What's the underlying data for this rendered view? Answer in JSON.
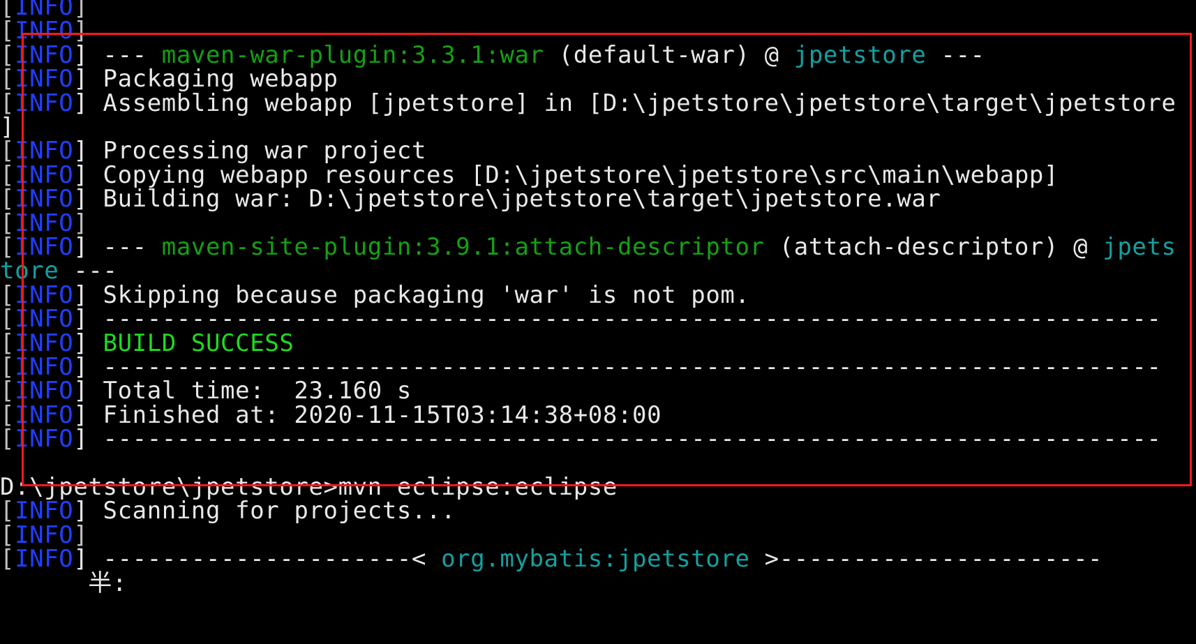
{
  "terminal": {
    "lines": [
      {
        "segments": [
          {
            "text": "[",
            "style": "bracket"
          },
          {
            "text": "INFO",
            "style": "tag"
          },
          {
            "text": "]",
            "style": "bracket"
          }
        ]
      },
      {
        "segments": [
          {
            "text": "[",
            "style": "bracket"
          },
          {
            "text": "INFO",
            "style": "tag"
          },
          {
            "text": "]",
            "style": "bracket"
          }
        ]
      },
      {
        "segments": [
          {
            "text": "[",
            "style": "bracket"
          },
          {
            "text": "INFO",
            "style": "tag"
          },
          {
            "text": "] --- ",
            "style": "bracket-white"
          },
          {
            "text": "maven-war-plugin:3.3.1:war",
            "style": "plugin"
          },
          {
            "text": " (default-war) @ ",
            "style": "white"
          },
          {
            "text": "jpetstore",
            "style": "project"
          },
          {
            "text": " ---",
            "style": "white"
          }
        ]
      },
      {
        "segments": [
          {
            "text": "[",
            "style": "bracket"
          },
          {
            "text": "INFO",
            "style": "tag"
          },
          {
            "text": "] Packaging webapp",
            "style": "bracket-white"
          }
        ]
      },
      {
        "segments": [
          {
            "text": "[",
            "style": "bracket"
          },
          {
            "text": "INFO",
            "style": "tag"
          },
          {
            "text": "] Assembling webapp [jpetstore] in [D:\\jpetstore\\jpetstore\\target\\jpetstore",
            "style": "bracket-white"
          }
        ]
      },
      {
        "segments": [
          {
            "text": "]",
            "style": "white"
          }
        ]
      },
      {
        "segments": [
          {
            "text": "[",
            "style": "bracket"
          },
          {
            "text": "INFO",
            "style": "tag"
          },
          {
            "text": "] Processing war project",
            "style": "bracket-white"
          }
        ]
      },
      {
        "segments": [
          {
            "text": "[",
            "style": "bracket"
          },
          {
            "text": "INFO",
            "style": "tag"
          },
          {
            "text": "] Copying webapp resources [D:\\jpetstore\\jpetstore\\src\\main\\webapp]",
            "style": "bracket-white"
          }
        ]
      },
      {
        "segments": [
          {
            "text": "[",
            "style": "bracket"
          },
          {
            "text": "INFO",
            "style": "tag"
          },
          {
            "text": "] Building war: D:\\jpetstore\\jpetstore\\target\\jpetstore.war",
            "style": "bracket-white"
          }
        ]
      },
      {
        "segments": [
          {
            "text": "[",
            "style": "bracket"
          },
          {
            "text": "INFO",
            "style": "tag"
          },
          {
            "text": "]",
            "style": "bracket"
          }
        ]
      },
      {
        "segments": [
          {
            "text": "[",
            "style": "bracket"
          },
          {
            "text": "INFO",
            "style": "tag"
          },
          {
            "text": "] --- ",
            "style": "bracket-white"
          },
          {
            "text": "maven-site-plugin:3.9.1:attach-descriptor",
            "style": "plugin"
          },
          {
            "text": " (attach-descriptor) @ ",
            "style": "white"
          },
          {
            "text": "jpets",
            "style": "project"
          }
        ]
      },
      {
        "segments": [
          {
            "text": "tore",
            "style": "project"
          },
          {
            "text": " ---",
            "style": "white"
          }
        ]
      },
      {
        "segments": [
          {
            "text": "[",
            "style": "bracket"
          },
          {
            "text": "INFO",
            "style": "tag"
          },
          {
            "text": "] Skipping because packaging 'war' is not pom.",
            "style": "bracket-white"
          }
        ]
      },
      {
        "segments": [
          {
            "text": "[",
            "style": "bracket"
          },
          {
            "text": "INFO",
            "style": "tag"
          },
          {
            "text": "] ------------------------------------------------------------------------",
            "style": "bracket-white"
          }
        ]
      },
      {
        "segments": [
          {
            "text": "[",
            "style": "bracket"
          },
          {
            "text": "INFO",
            "style": "tag"
          },
          {
            "text": "] ",
            "style": "bracket-white"
          },
          {
            "text": "BUILD SUCCESS",
            "style": "success"
          }
        ]
      },
      {
        "segments": [
          {
            "text": "[",
            "style": "bracket"
          },
          {
            "text": "INFO",
            "style": "tag"
          },
          {
            "text": "] ------------------------------------------------------------------------",
            "style": "bracket-white"
          }
        ]
      },
      {
        "segments": [
          {
            "text": "[",
            "style": "bracket"
          },
          {
            "text": "INFO",
            "style": "tag"
          },
          {
            "text": "] Total time:  23.160 s",
            "style": "bracket-white"
          }
        ]
      },
      {
        "segments": [
          {
            "text": "[",
            "style": "bracket"
          },
          {
            "text": "INFO",
            "style": "tag"
          },
          {
            "text": "] Finished at: 2020-11-15T03:14:38+08:00",
            "style": "bracket-white"
          }
        ]
      },
      {
        "segments": [
          {
            "text": "[",
            "style": "bracket"
          },
          {
            "text": "INFO",
            "style": "tag"
          },
          {
            "text": "] ------------------------------------------------------------------------",
            "style": "bracket-white"
          }
        ]
      },
      {
        "segments": []
      },
      {
        "segments": [
          {
            "text": "D:\\jpetstore\\jpetstore>mvn eclipse:eclipse",
            "style": "white"
          }
        ]
      },
      {
        "segments": [
          {
            "text": "[",
            "style": "bracket"
          },
          {
            "text": "INFO",
            "style": "tag"
          },
          {
            "text": "] Scanning for projects...",
            "style": "bracket-white"
          }
        ]
      },
      {
        "segments": [
          {
            "text": "[",
            "style": "bracket"
          },
          {
            "text": "INFO",
            "style": "tag"
          },
          {
            "text": "]",
            "style": "bracket"
          }
        ]
      },
      {
        "segments": [
          {
            "text": "[",
            "style": "bracket"
          },
          {
            "text": "INFO",
            "style": "tag"
          },
          {
            "text": "] ---------------------< ",
            "style": "bracket-white"
          },
          {
            "text": "org.mybatis:jpetstore",
            "style": "project"
          },
          {
            "text": " >----------------------",
            "style": "white"
          }
        ]
      },
      {
        "segments": [
          {
            "text": "      半:",
            "style": "white"
          }
        ]
      }
    ]
  },
  "colors": {
    "background": "#000000",
    "tag": "#1f3fff",
    "plugin": "#14a014",
    "project": "#14a0a0",
    "success": "#1edc1e",
    "text": "#e8e8e8",
    "highlight_border": "#ff1a1a"
  }
}
